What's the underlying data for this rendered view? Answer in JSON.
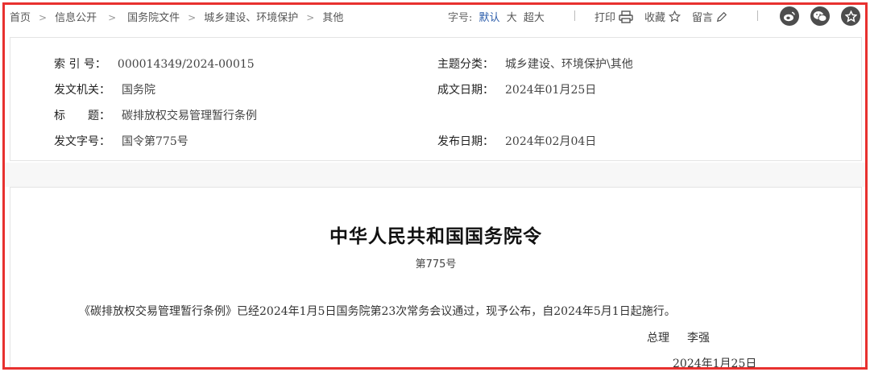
{
  "breadcrumb": {
    "items": [
      "首页",
      "信息公开",
      "国务院文件",
      "城乡建设、环境保护",
      "其他"
    ],
    "separator": ">"
  },
  "font_size": {
    "label": "字号:",
    "options": [
      "默认",
      "大",
      "超大"
    ],
    "active": "默认"
  },
  "tools": {
    "print": "打印",
    "favorite": "收藏",
    "comment": "留言"
  },
  "social": [
    "weibo-icon",
    "wechat-icon",
    "favorite-star-icon"
  ],
  "meta": {
    "index_label": "索 引 号：",
    "index_value": "000014349/2024-00015",
    "category_label": "主题分类：",
    "category_value": "城乡建设、环境保护\\其他",
    "issuer_label": "发文机关：",
    "issuer_value": "国务院",
    "written_date_label": "成文日期：",
    "written_date_value": "2024年01月25日",
    "title_label": "标　　题：",
    "title_value": "碳排放权交易管理暂行条例",
    "doc_no_label": "发文字号：",
    "doc_no_value": "国令第775号",
    "publish_date_label": "发布日期：",
    "publish_date_value": "2024年02月04日"
  },
  "document": {
    "title": "中华人民共和国国务院令",
    "number": "第775号",
    "body": "《碳排放权交易管理暂行条例》已经2024年1月5日国务院第23次常务会议通过，现予公布，自2024年5月1日起施行。",
    "signer_title": "总理",
    "signer_name": "李强",
    "date": "2024年1月25日"
  },
  "colors": {
    "frame": "#e8312f",
    "active_link": "#2a5caa",
    "icon_bg": "#4d4d4d"
  }
}
